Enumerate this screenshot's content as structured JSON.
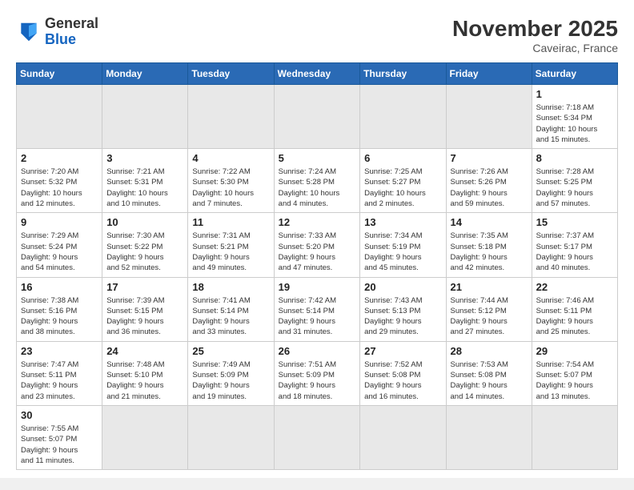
{
  "header": {
    "logo_general": "General",
    "logo_blue": "Blue",
    "month": "November 2025",
    "location": "Caveirac, France"
  },
  "days_of_week": [
    "Sunday",
    "Monday",
    "Tuesday",
    "Wednesday",
    "Thursday",
    "Friday",
    "Saturday"
  ],
  "weeks": [
    [
      {
        "day": "",
        "info": ""
      },
      {
        "day": "",
        "info": ""
      },
      {
        "day": "",
        "info": ""
      },
      {
        "day": "",
        "info": ""
      },
      {
        "day": "",
        "info": ""
      },
      {
        "day": "",
        "info": ""
      },
      {
        "day": "1",
        "info": "Sunrise: 7:18 AM\nSunset: 5:34 PM\nDaylight: 10 hours\nand 15 minutes."
      }
    ],
    [
      {
        "day": "2",
        "info": "Sunrise: 7:20 AM\nSunset: 5:32 PM\nDaylight: 10 hours\nand 12 minutes."
      },
      {
        "day": "3",
        "info": "Sunrise: 7:21 AM\nSunset: 5:31 PM\nDaylight: 10 hours\nand 10 minutes."
      },
      {
        "day": "4",
        "info": "Sunrise: 7:22 AM\nSunset: 5:30 PM\nDaylight: 10 hours\nand 7 minutes."
      },
      {
        "day": "5",
        "info": "Sunrise: 7:24 AM\nSunset: 5:28 PM\nDaylight: 10 hours\nand 4 minutes."
      },
      {
        "day": "6",
        "info": "Sunrise: 7:25 AM\nSunset: 5:27 PM\nDaylight: 10 hours\nand 2 minutes."
      },
      {
        "day": "7",
        "info": "Sunrise: 7:26 AM\nSunset: 5:26 PM\nDaylight: 9 hours\nand 59 minutes."
      },
      {
        "day": "8",
        "info": "Sunrise: 7:28 AM\nSunset: 5:25 PM\nDaylight: 9 hours\nand 57 minutes."
      }
    ],
    [
      {
        "day": "9",
        "info": "Sunrise: 7:29 AM\nSunset: 5:24 PM\nDaylight: 9 hours\nand 54 minutes."
      },
      {
        "day": "10",
        "info": "Sunrise: 7:30 AM\nSunset: 5:22 PM\nDaylight: 9 hours\nand 52 minutes."
      },
      {
        "day": "11",
        "info": "Sunrise: 7:31 AM\nSunset: 5:21 PM\nDaylight: 9 hours\nand 49 minutes."
      },
      {
        "day": "12",
        "info": "Sunrise: 7:33 AM\nSunset: 5:20 PM\nDaylight: 9 hours\nand 47 minutes."
      },
      {
        "day": "13",
        "info": "Sunrise: 7:34 AM\nSunset: 5:19 PM\nDaylight: 9 hours\nand 45 minutes."
      },
      {
        "day": "14",
        "info": "Sunrise: 7:35 AM\nSunset: 5:18 PM\nDaylight: 9 hours\nand 42 minutes."
      },
      {
        "day": "15",
        "info": "Sunrise: 7:37 AM\nSunset: 5:17 PM\nDaylight: 9 hours\nand 40 minutes."
      }
    ],
    [
      {
        "day": "16",
        "info": "Sunrise: 7:38 AM\nSunset: 5:16 PM\nDaylight: 9 hours\nand 38 minutes."
      },
      {
        "day": "17",
        "info": "Sunrise: 7:39 AM\nSunset: 5:15 PM\nDaylight: 9 hours\nand 36 minutes."
      },
      {
        "day": "18",
        "info": "Sunrise: 7:41 AM\nSunset: 5:14 PM\nDaylight: 9 hours\nand 33 minutes."
      },
      {
        "day": "19",
        "info": "Sunrise: 7:42 AM\nSunset: 5:14 PM\nDaylight: 9 hours\nand 31 minutes."
      },
      {
        "day": "20",
        "info": "Sunrise: 7:43 AM\nSunset: 5:13 PM\nDaylight: 9 hours\nand 29 minutes."
      },
      {
        "day": "21",
        "info": "Sunrise: 7:44 AM\nSunset: 5:12 PM\nDaylight: 9 hours\nand 27 minutes."
      },
      {
        "day": "22",
        "info": "Sunrise: 7:46 AM\nSunset: 5:11 PM\nDaylight: 9 hours\nand 25 minutes."
      }
    ],
    [
      {
        "day": "23",
        "info": "Sunrise: 7:47 AM\nSunset: 5:11 PM\nDaylight: 9 hours\nand 23 minutes."
      },
      {
        "day": "24",
        "info": "Sunrise: 7:48 AM\nSunset: 5:10 PM\nDaylight: 9 hours\nand 21 minutes."
      },
      {
        "day": "25",
        "info": "Sunrise: 7:49 AM\nSunset: 5:09 PM\nDaylight: 9 hours\nand 19 minutes."
      },
      {
        "day": "26",
        "info": "Sunrise: 7:51 AM\nSunset: 5:09 PM\nDaylight: 9 hours\nand 18 minutes."
      },
      {
        "day": "27",
        "info": "Sunrise: 7:52 AM\nSunset: 5:08 PM\nDaylight: 9 hours\nand 16 minutes."
      },
      {
        "day": "28",
        "info": "Sunrise: 7:53 AM\nSunset: 5:08 PM\nDaylight: 9 hours\nand 14 minutes."
      },
      {
        "day": "29",
        "info": "Sunrise: 7:54 AM\nSunset: 5:07 PM\nDaylight: 9 hours\nand 13 minutes."
      }
    ],
    [
      {
        "day": "30",
        "info": "Sunrise: 7:55 AM\nSunset: 5:07 PM\nDaylight: 9 hours\nand 11 minutes."
      },
      {
        "day": "",
        "info": ""
      },
      {
        "day": "",
        "info": ""
      },
      {
        "day": "",
        "info": ""
      },
      {
        "day": "",
        "info": ""
      },
      {
        "day": "",
        "info": ""
      },
      {
        "day": "",
        "info": ""
      }
    ]
  ]
}
